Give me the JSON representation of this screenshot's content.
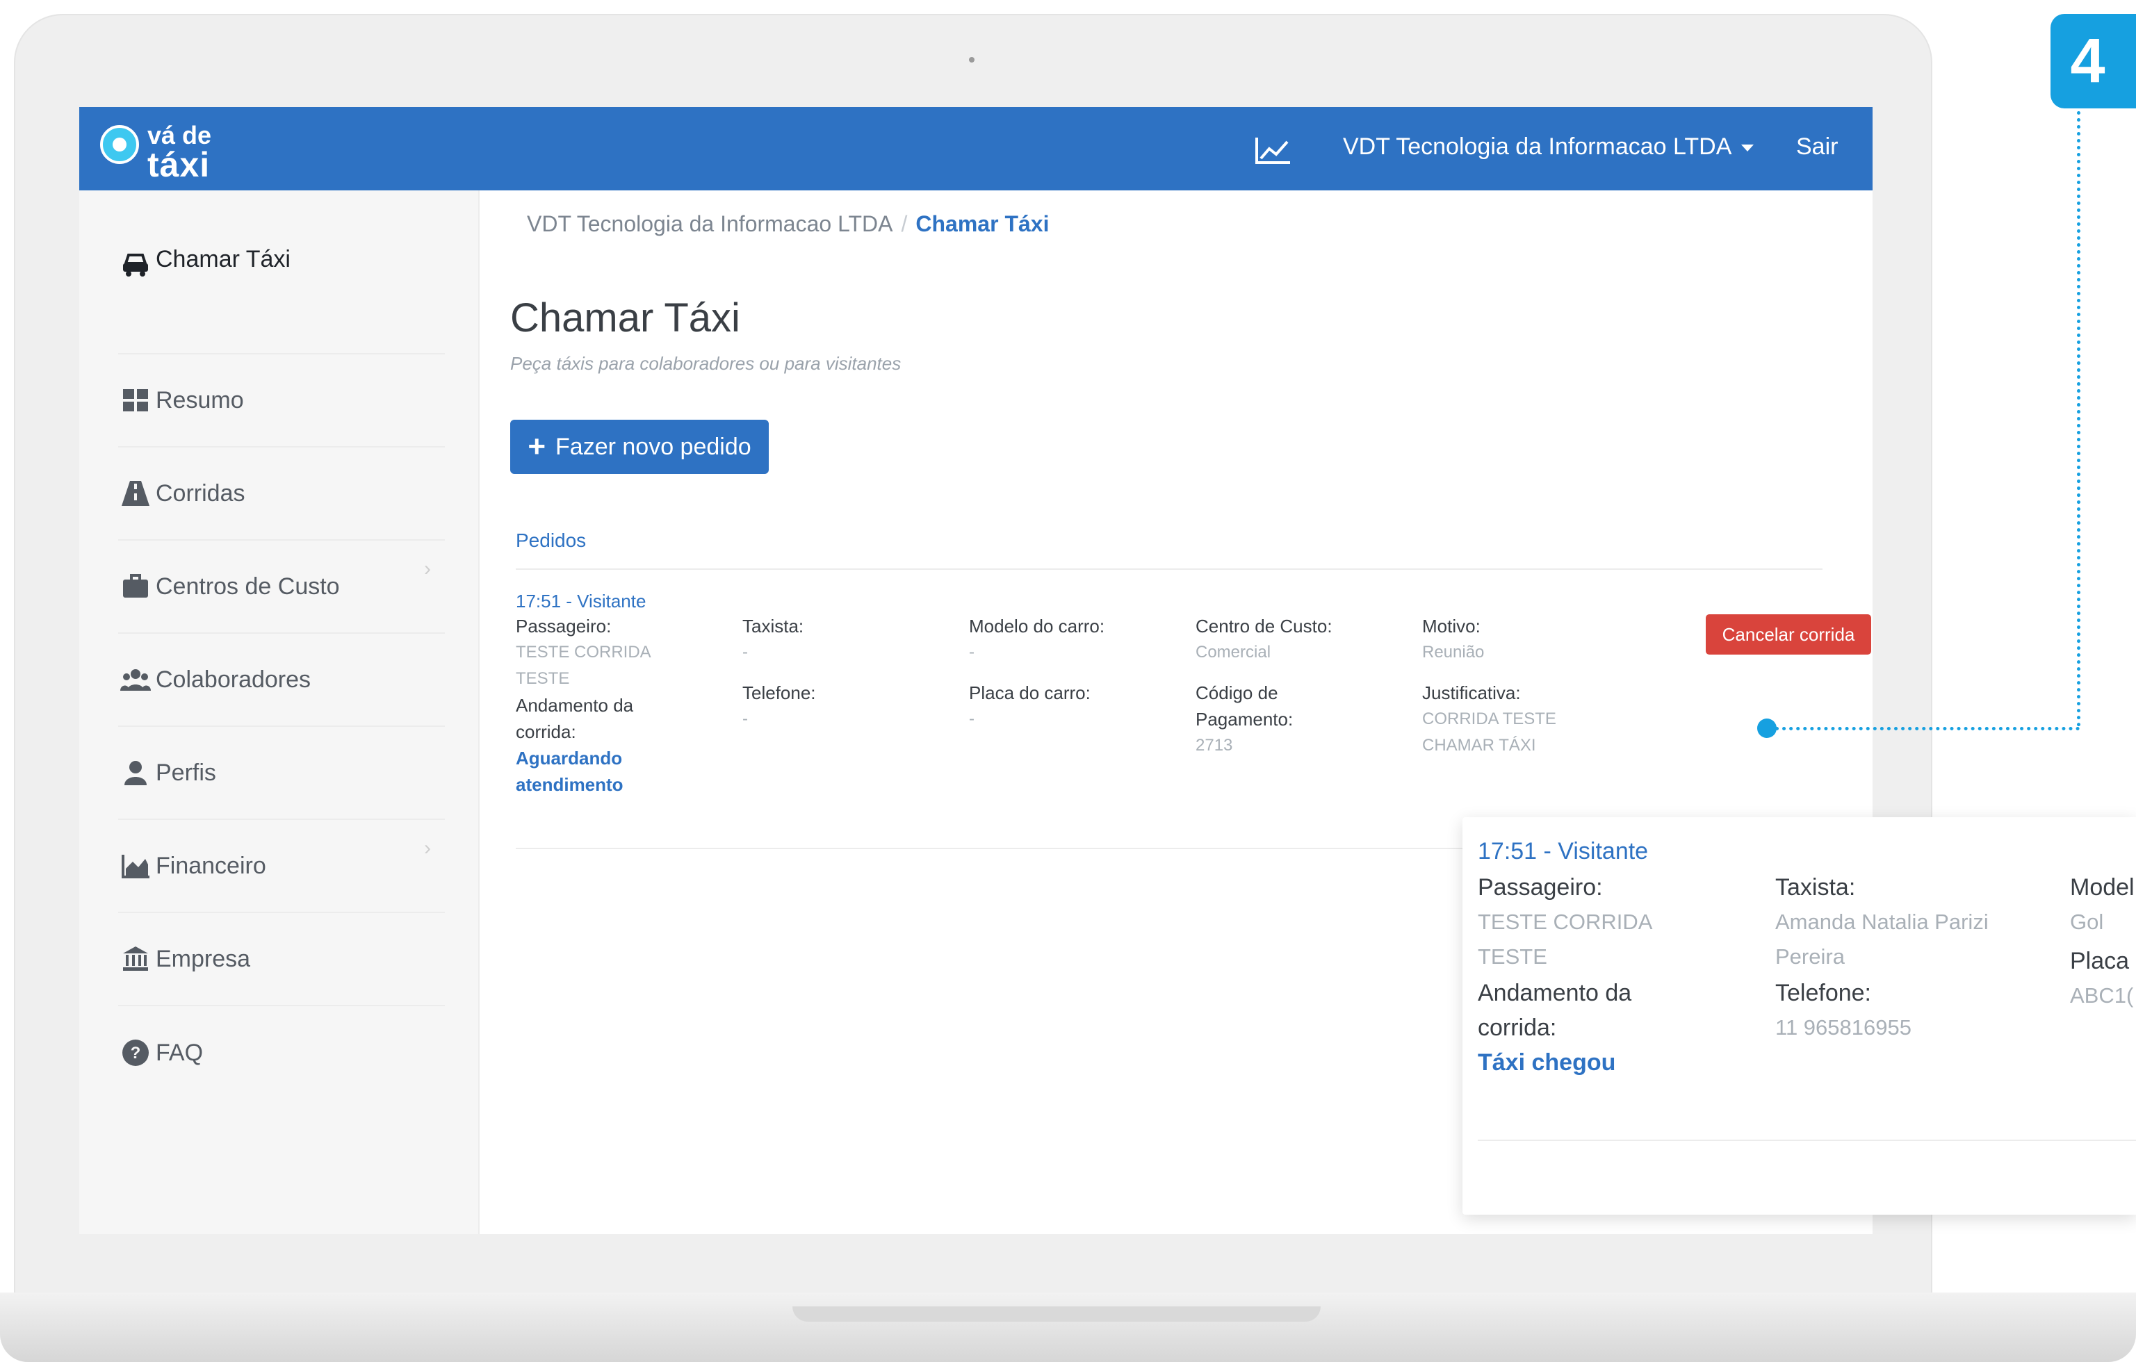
{
  "brand": {
    "line1": "vá de",
    "line2": "táxi"
  },
  "topbar": {
    "company": "VDT Tecnologia da Informacao LTDA",
    "logout": "Sair"
  },
  "sidebar": {
    "items": [
      {
        "label": "Chamar Táxi",
        "icon": "car-icon"
      },
      {
        "label": "Resumo",
        "icon": "dashboard-icon"
      },
      {
        "label": "Corridas",
        "icon": "road-icon"
      },
      {
        "label": "Centros de Custo",
        "icon": "briefcase-icon"
      },
      {
        "label": "Colaboradores",
        "icon": "users-icon"
      },
      {
        "label": "Perfis",
        "icon": "user-icon"
      },
      {
        "label": "Financeiro",
        "icon": "area-chart-icon"
      },
      {
        "label": "Empresa",
        "icon": "bank-icon"
      },
      {
        "label": "FAQ",
        "icon": "question-icon"
      }
    ]
  },
  "breadcrumb": {
    "parent": "VDT Tecnologia da Informacao LTDA",
    "separator": "/",
    "current": "Chamar Táxi"
  },
  "page": {
    "title": "Chamar Táxi",
    "subtitle": "Peça táxis para colaboradores ou para visitantes",
    "new_order": "Fazer novo pedido",
    "orders_title": "Pedidos"
  },
  "order": {
    "header": "17:51 - Visitante",
    "passenger_label": "Passageiro:",
    "passenger_value_line1": "TESTE CORRIDA",
    "passenger_value_line2": "TESTE",
    "progress_label_line1": "Andamento da",
    "progress_label_line2": "corrida:",
    "progress_value_line1": "Aguardando",
    "progress_value_line2": "atendimento",
    "driver_label": "Taxista:",
    "driver_value": "-",
    "phone_label": "Telefone:",
    "phone_value": "-",
    "car_model_label": "Modelo do carro:",
    "car_model_value": "-",
    "plate_label": "Placa do carro:",
    "plate_value": "-",
    "cost_center_label": "Centro de Custo:",
    "cost_center_value": "Comercial",
    "payment_code_label_line1": "Código de",
    "payment_code_label_line2": "Pagamento:",
    "payment_code_value": "2713",
    "reason_label": "Motivo:",
    "reason_value": "Reunião",
    "justification_label": "Justificativa:",
    "justification_value_line1": "CORRIDA TESTE",
    "justification_value_line2": "CHAMAR TÁXI",
    "cancel_button": "Cancelar corrida"
  },
  "callout": {
    "number": "4",
    "color": "#16a0e0"
  },
  "zoom": {
    "header": "17:51 - Visitante",
    "passenger_label": "Passageiro:",
    "passenger_value_line1": "TESTE CORRIDA",
    "passenger_value_line2": "TESTE",
    "progress_label_line1": "Andamento da",
    "progress_label_line2": "corrida:",
    "progress_value": "Táxi chegou",
    "driver_label": "Taxista:",
    "driver_value_line1": "Amanda Natalia Parizi",
    "driver_value_line2": "Pereira",
    "phone_label": "Telefone:",
    "phone_value": "11 965816955",
    "model_label_partial": "Model",
    "model_value": "Gol",
    "plate_label_partial": "Placa",
    "plate_value_partial": "ABC1("
  },
  "colors": {
    "brand_blue": "#2e72c3",
    "danger_red": "#d9443c",
    "callout_blue": "#16a0e0"
  }
}
